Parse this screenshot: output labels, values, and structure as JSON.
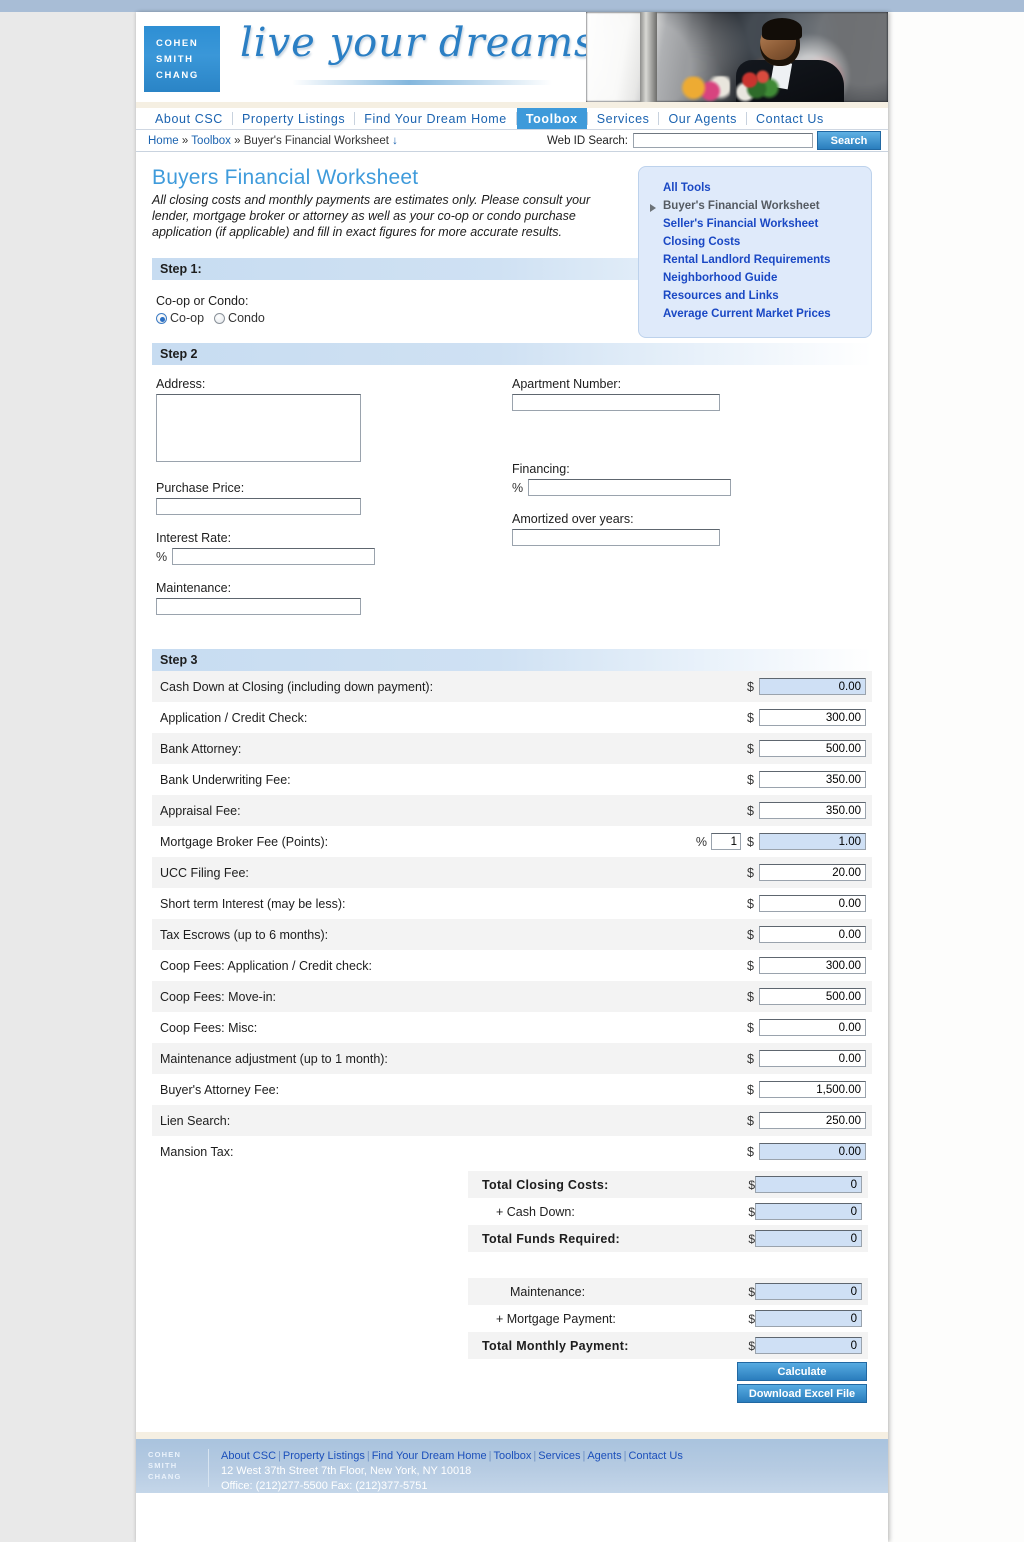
{
  "brand": {
    "logo_lines": [
      "COHEN",
      "SMITH",
      "CHANG"
    ],
    "tagline": "live your dreams"
  },
  "nav": {
    "items": [
      {
        "label": "About CSC",
        "active": false
      },
      {
        "label": "Property Listings",
        "active": false
      },
      {
        "label": "Find Your Dream Home",
        "active": false
      },
      {
        "label": "Toolbox",
        "active": true
      },
      {
        "label": "Services",
        "active": false
      },
      {
        "label": "Our Agents",
        "active": false
      },
      {
        "label": "Contact Us",
        "active": false
      }
    ]
  },
  "breadcrumb": {
    "home": "Home",
    "sep1": "»",
    "section": "Toolbox",
    "sep2": "»",
    "current": "Buyer's Financial Worksheet",
    "arrow": "↓"
  },
  "search": {
    "label": "Web ID Search:",
    "value": "",
    "placeholder": "",
    "button": "Search"
  },
  "page": {
    "title": "Buyers Financial Worksheet",
    "intro": "All closing costs and monthly payments are estimates only. Please consult your lender, mortgage broker or attorney as well as your co-op or condo purchase application (if applicable) and fill in exact figures for more accurate results."
  },
  "tools": [
    {
      "label": "All Tools",
      "current": false
    },
    {
      "label": "Buyer's Financial Worksheet",
      "current": true
    },
    {
      "label": "Seller's Financial Worksheet",
      "current": false
    },
    {
      "label": "Closing Costs",
      "current": false
    },
    {
      "label": "Rental Landlord Requirements",
      "current": false
    },
    {
      "label": "Neighborhood Guide",
      "current": false
    },
    {
      "label": "Resources and Links",
      "current": false
    },
    {
      "label": "Average Current Market Prices",
      "current": false
    }
  ],
  "step1": {
    "heading": "Step 1:",
    "label": "Co-op or Condo:",
    "options": [
      {
        "label": "Co-op",
        "selected": true
      },
      {
        "label": "Condo",
        "selected": false
      }
    ]
  },
  "step2": {
    "heading": "Step 2",
    "address": {
      "label": "Address:",
      "value": ""
    },
    "apartment": {
      "label": "Apartment Number:",
      "value": ""
    },
    "purchase_price": {
      "label": "Purchase Price:",
      "value": ""
    },
    "financing": {
      "label": "Financing:",
      "prefix": "%",
      "value": ""
    },
    "interest_rate": {
      "label": "Interest Rate:",
      "prefix": "%",
      "value": ""
    },
    "amortized": {
      "label": "Amortized over years:",
      "value": ""
    },
    "maintenance": {
      "label": "Maintenance:",
      "value": ""
    }
  },
  "step3": {
    "heading": "Step 3",
    "currency": "$",
    "percent": "%",
    "rows": [
      {
        "label": "Cash Down at Closing (including down payment):",
        "value": "0.00",
        "readonly": true
      },
      {
        "label": "Application / Credit Check:",
        "value": "300.00",
        "readonly": false
      },
      {
        "label": "Bank Attorney:",
        "value": "500.00",
        "readonly": false
      },
      {
        "label": "Bank Underwriting Fee:",
        "value": "350.00",
        "readonly": false
      },
      {
        "label": "Appraisal Fee:",
        "value": "350.00",
        "readonly": false
      },
      {
        "label": "Mortgage Broker Fee (Points):",
        "value": "1.00",
        "readonly": true,
        "pct_value": "1"
      },
      {
        "label": "UCC Filing Fee:",
        "value": "20.00",
        "readonly": false
      },
      {
        "label": "Short term Interest (may be less):",
        "value": "0.00",
        "readonly": false
      },
      {
        "label": "Tax Escrows (up to 6 months):",
        "value": "0.00",
        "readonly": false
      },
      {
        "label": "Coop Fees: Application / Credit check:",
        "value": "300.00",
        "readonly": false
      },
      {
        "label": "Coop Fees: Move-in:",
        "value": "500.00",
        "readonly": false
      },
      {
        "label": "Coop Fees: Misc:",
        "value": "0.00",
        "readonly": false
      },
      {
        "label": "Maintenance adjustment (up to 1 month):",
        "value": "0.00",
        "readonly": false
      },
      {
        "label": "Buyer's Attorney Fee:",
        "value": "1,500.00",
        "readonly": false
      },
      {
        "label": "Lien Search:",
        "value": "250.00",
        "readonly": false
      },
      {
        "label": "Mansion Tax:",
        "value": "0.00",
        "readonly": true
      }
    ]
  },
  "totals_a": [
    {
      "label": "Total Closing Costs:",
      "value": "0",
      "bold": true,
      "indent": 0
    },
    {
      "label": "+ Cash Down:",
      "value": "0",
      "bold": false,
      "indent": 1
    },
    {
      "label": "Total Funds Required:",
      "value": "0",
      "bold": true,
      "indent": 0
    }
  ],
  "totals_b": [
    {
      "label": "Maintenance:",
      "value": "0",
      "bold": false,
      "indent": 2
    },
    {
      "label": "+ Mortgage Payment:",
      "value": "0",
      "bold": false,
      "indent": 1
    },
    {
      "label": "Total Monthly Payment:",
      "value": "0",
      "bold": true,
      "indent": 0
    }
  ],
  "buttons": {
    "calculate": "Calculate",
    "download": "Download Excel File"
  },
  "footer": {
    "logo_lines": [
      "COHEN",
      "SMITH",
      "CHANG"
    ],
    "links": [
      "About CSC",
      "Property Listings",
      "Find Your Dream Home",
      "Toolbox",
      "Services",
      "Agents",
      "Contact Us"
    ],
    "address": "12 West 37th Street 7th Floor, New York, NY 10018",
    "phone": "Office: (212)277-5500 Fax: (212)377-5751"
  },
  "colors": {
    "accent": "#3e9ada",
    "link": "#1a48c4",
    "title": "#3f9bdb",
    "readonly_field": "#cfe0f5"
  }
}
